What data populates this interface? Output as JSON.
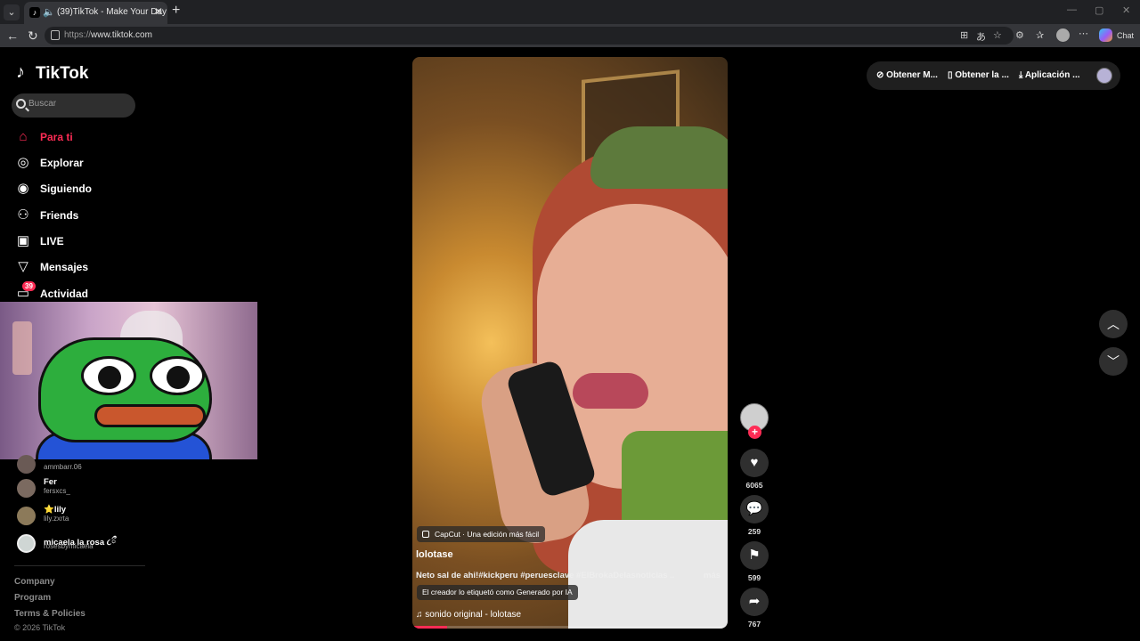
{
  "browser": {
    "tab_title": "(39)TikTok - Make Your Day",
    "url_scheme": "https://",
    "url_host": "www.tiktok.com",
    "chat_label": "Chat"
  },
  "brand": {
    "name": "TikTok",
    "accent": "#fe2c55"
  },
  "search": {
    "placeholder": "Buscar"
  },
  "nav": {
    "for_you": "Para ti",
    "explore": "Explorar",
    "following": "Siguiendo",
    "friends": "Friends",
    "live": "LIVE",
    "messages": "Mensajes",
    "activity": "Actividad",
    "activity_badge": "39"
  },
  "following_accounts": [
    {
      "name": "",
      "handle": "ammbarr.06"
    },
    {
      "name": "Fer",
      "handle": "fersxcs_"
    },
    {
      "name": "⭐lily",
      "handle": "lily.zxrta"
    },
    {
      "name": "micaela la rosa ૮⁠ྀ",
      "handle": "rosesbymicaela"
    }
  ],
  "footer": {
    "company": "Company",
    "program": "Program",
    "terms": "Terms & Policies",
    "copyright": "© 2026 TikTok"
  },
  "video": {
    "capcut_label": "CapCut · Una edición más fácil",
    "author": "lolotase",
    "description": "Neto sal de ahi!#kickperu #peruesclave #ElBrokaDelasnoticias ...",
    "more_label": "más",
    "ai_label": "El creador lo etiquetó como Generado por IA",
    "sound": "sonido original - lolotase",
    "progress": 0.11
  },
  "actions": {
    "likes": "6065",
    "comments": "259",
    "saves": "599",
    "shares": "767"
  },
  "top_right": {
    "get_coins": "Obtener M...",
    "get_app": "Obtener la ...",
    "desktop_app": "Aplicación ..."
  }
}
